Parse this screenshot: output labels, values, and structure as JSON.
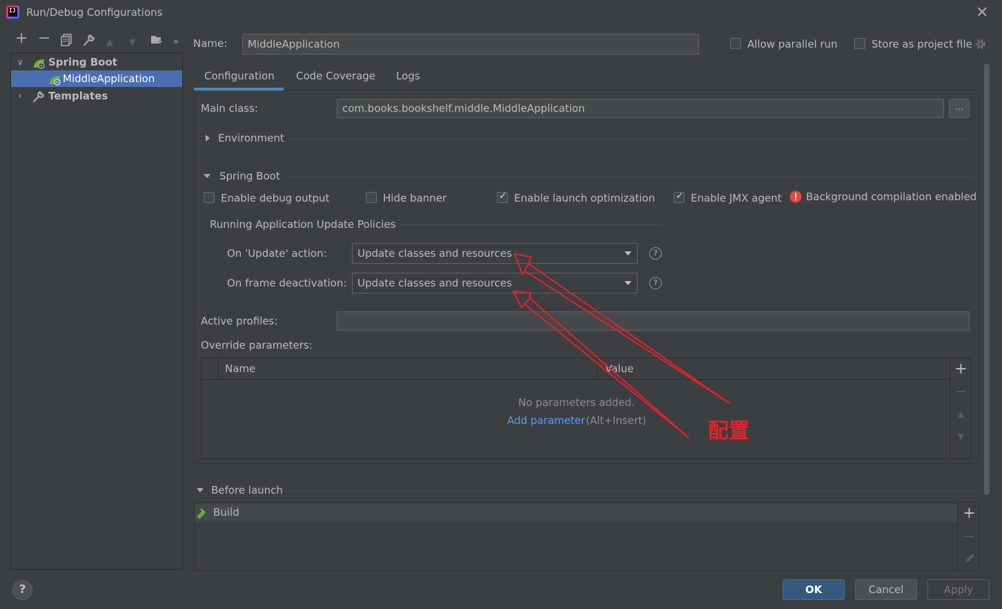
{
  "window": {
    "title": "Run/Debug Configurations",
    "app_icon_text": "IJ"
  },
  "toolbar": {
    "add": "+",
    "remove": "−",
    "copy": "⧉",
    "edit_defaults": "🔧",
    "move_up": "▲",
    "move_down": "▼",
    "new_folder": "📁",
    "more": "»"
  },
  "tree": {
    "group_spring_boot": "Spring Boot",
    "item_middle_application": "MiddleApplication",
    "group_templates": "Templates"
  },
  "header": {
    "name_label": "Name:",
    "name_value": "MiddleApplication",
    "allow_parallel_run": "Allow parallel run",
    "store_as_project_file": "Store as project file"
  },
  "tabs": [
    {
      "label": "Configuration",
      "active": true
    },
    {
      "label": "Code Coverage",
      "active": false
    },
    {
      "label": "Logs",
      "active": false
    }
  ],
  "config": {
    "main_class_label": "Main class:",
    "main_class_value": "com.books.bookshelf.middle.MiddleApplication",
    "browse_label": "...",
    "environment_label": "Environment",
    "spring_boot_label": "Spring Boot",
    "enable_debug_output": "Enable debug output",
    "hide_banner": "Hide banner",
    "enable_launch_optimization": "Enable launch optimization",
    "enable_jmx_agent": "Enable JMX agent",
    "background_compilation": "Background compilation enabled",
    "update_policies_label": "Running Application Update Policies",
    "on_update_label": "On 'Update' action:",
    "on_update_value": "Update classes and resources",
    "on_frame_label": "On frame deactivation:",
    "on_frame_value": "Update classes and resources",
    "help_glyph": "?",
    "active_profiles_label": "Active profiles:",
    "active_profiles_value": "",
    "override_label": "Override parameters:",
    "table": {
      "columns": [
        "Name",
        "Value"
      ],
      "empty_text": "No parameters added.",
      "add_link": "Add parameter",
      "add_shortcut": "(Alt+Insert)"
    }
  },
  "before_launch": {
    "label": "Before launch",
    "items": [
      "Build"
    ]
  },
  "annotation": {
    "text": "配置",
    "color": "#e8202a"
  },
  "footer": {
    "help": "?",
    "ok": "OK",
    "cancel": "Cancel",
    "apply": "Apply"
  },
  "colors": {
    "background": "#3c3f41",
    "selection": "#4b6eaf",
    "tab_underline": "#4a88c7",
    "link": "#589df6",
    "error": "#e5493a",
    "ok_button": "#365880"
  }
}
